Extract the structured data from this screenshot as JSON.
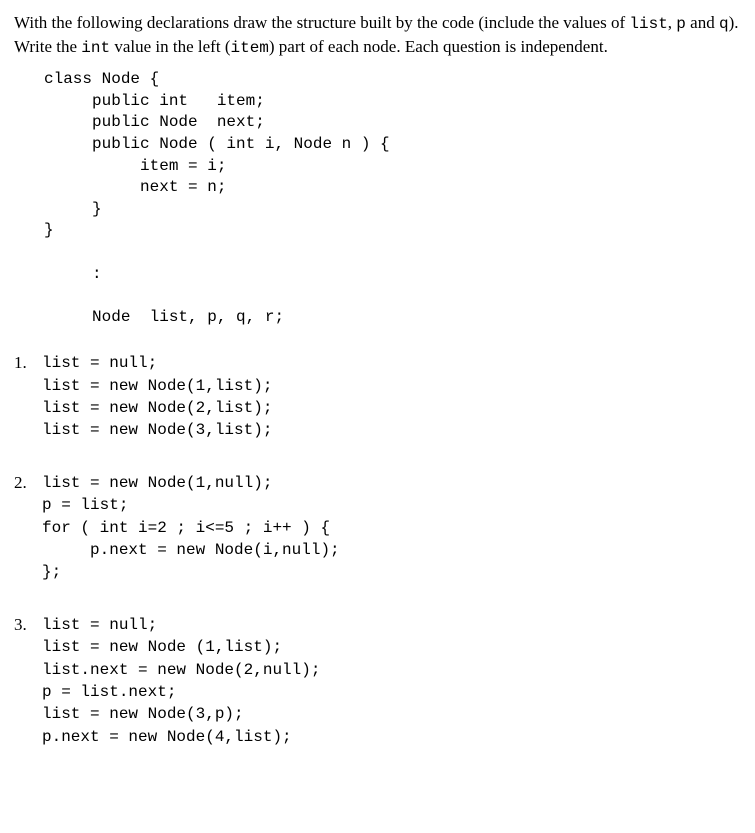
{
  "intro": {
    "part1": "With the following declarations draw the structure built by the code (include the values of ",
    "code1": "list",
    "sep1": ", ",
    "code2": "p",
    "part2": " and ",
    "code3": "q",
    "part3": "). Write the ",
    "code4": "int",
    "part4": " value in the left (",
    "code5": "item",
    "part5": ") part of each node. Each question is independent."
  },
  "class_code": "class Node {\n     public int   item;\n     public Node  next;\n     public Node ( int i, Node n ) {\n          item = i;\n          next = n;\n     }\n}\n\n     :\n\n     Node  list, p, q, r;",
  "questions": [
    {
      "num": "1.",
      "code": "list = null;\nlist = new Node(1,list);\nlist = new Node(2,list);\nlist = new Node(3,list);"
    },
    {
      "num": "2.",
      "code": "list = new Node(1,null);\np = list;\nfor ( int i=2 ; i<=5 ; i++ ) {\n     p.next = new Node(i,null);\n};"
    },
    {
      "num": "3.",
      "code": "list = null;\nlist = new Node (1,list);\nlist.next = new Node(2,null);\np = list.next;\nlist = new Node(3,p);\np.next = new Node(4,list);"
    }
  ]
}
